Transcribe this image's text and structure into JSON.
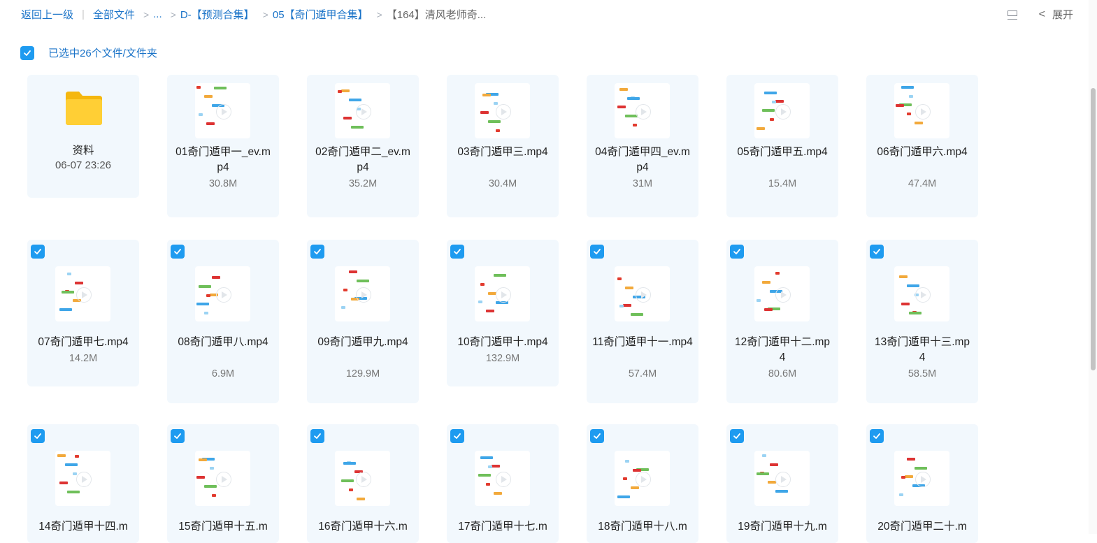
{
  "breadcrumb": {
    "back": "返回上一级",
    "all_files": "全部文件",
    "ellipsis": "...",
    "level1": "D-【预测合集】",
    "level2": "05【奇门遁甲合集】",
    "current": "【164】清风老师奇..."
  },
  "topright": {
    "expand_label": "展开"
  },
  "selection": {
    "text": "已选中26个文件/文件夹"
  },
  "folder": {
    "name": "资料",
    "date": "06-07 23:26"
  },
  "files": [
    {
      "name": "01奇门遁甲一_ev.mp4",
      "size": "30.8M",
      "selected": false
    },
    {
      "name": "02奇门遁甲二_ev.mp4",
      "size": "35.2M",
      "selected": false
    },
    {
      "name": "03奇门遁甲三.mp4",
      "size": "30.4M",
      "selected": false
    },
    {
      "name": "04奇门遁甲四_ev.mp4",
      "size": "31M",
      "selected": false
    },
    {
      "name": "05奇门遁甲五.mp4",
      "size": "15.4M",
      "selected": false
    },
    {
      "name": "06奇门遁甲六.mp4",
      "size": "47.4M",
      "selected": false
    },
    {
      "name": "07奇门遁甲七.mp4",
      "size": "14.2M",
      "selected": true
    },
    {
      "name": "08奇门遁甲八.mp4",
      "size": "6.9M",
      "selected": true
    },
    {
      "name": "09奇门遁甲九.mp4",
      "size": "129.9M",
      "selected": true
    },
    {
      "name": "10奇门遁甲十.mp4",
      "size": "132.9M",
      "selected": true
    },
    {
      "name": "11奇门遁甲十一.mp4",
      "size": "57.4M",
      "selected": true
    },
    {
      "name": "12奇门遁甲十二.mp4",
      "size": "80.6M",
      "selected": true
    },
    {
      "name": "13奇门遁甲十三.mp4",
      "size": "58.5M",
      "selected": true
    },
    {
      "name": "14奇门遁甲十四.m",
      "size": "",
      "selected": true
    },
    {
      "name": "15奇门遁甲十五.m",
      "size": "",
      "selected": true
    },
    {
      "name": "16奇门遁甲十六.m",
      "size": "",
      "selected": true
    },
    {
      "name": "17奇门遁甲十七.m",
      "size": "",
      "selected": true
    },
    {
      "name": "18奇门遁甲十八.m",
      "size": "",
      "selected": true
    },
    {
      "name": "19奇门遁甲十九.m",
      "size": "",
      "selected": true
    },
    {
      "name": "20奇门遁甲二十.m",
      "size": "",
      "selected": true
    }
  ],
  "colors": {
    "accent": "#1e9bf0",
    "link": "#1a73c8",
    "card": "#f2f8fd"
  }
}
